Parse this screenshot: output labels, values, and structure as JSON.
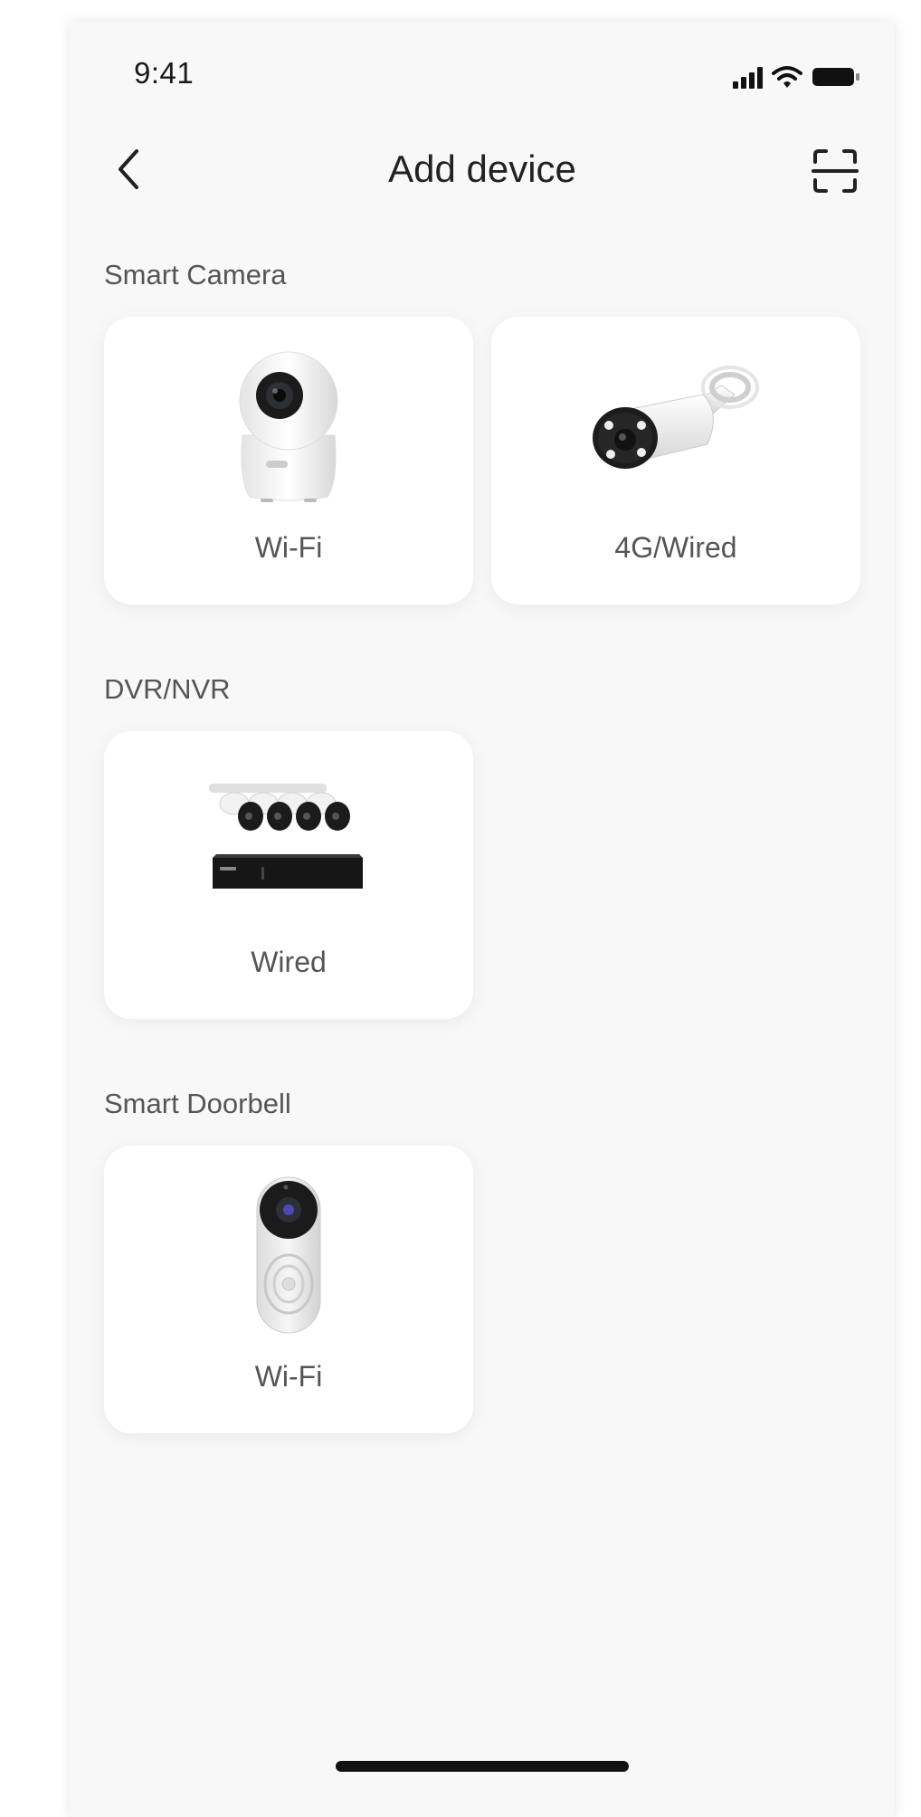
{
  "status_bar": {
    "time": "9:41",
    "icons": [
      "signal-icon",
      "wifi-icon",
      "battery-icon"
    ]
  },
  "header": {
    "title": "Add device",
    "back_icon": "chevron-left-icon",
    "scan_icon": "scan-icon"
  },
  "sections": [
    {
      "title": "Smart Camera",
      "devices": [
        {
          "label": "Wi-Fi",
          "icon": "pan-tilt-camera-icon"
        },
        {
          "label": "4G/Wired",
          "icon": "bullet-camera-icon"
        }
      ]
    },
    {
      "title": "DVR/NVR",
      "devices": [
        {
          "label": "Wired",
          "icon": "nvr-kit-icon"
        }
      ]
    },
    {
      "title": "Smart Doorbell",
      "devices": [
        {
          "label": "Wi-Fi",
          "icon": "video-doorbell-icon"
        }
      ]
    }
  ],
  "colors": {
    "background": "#f8f8f8",
    "card": "#ffffff",
    "title_text": "#222222",
    "label_text": "#555555"
  }
}
